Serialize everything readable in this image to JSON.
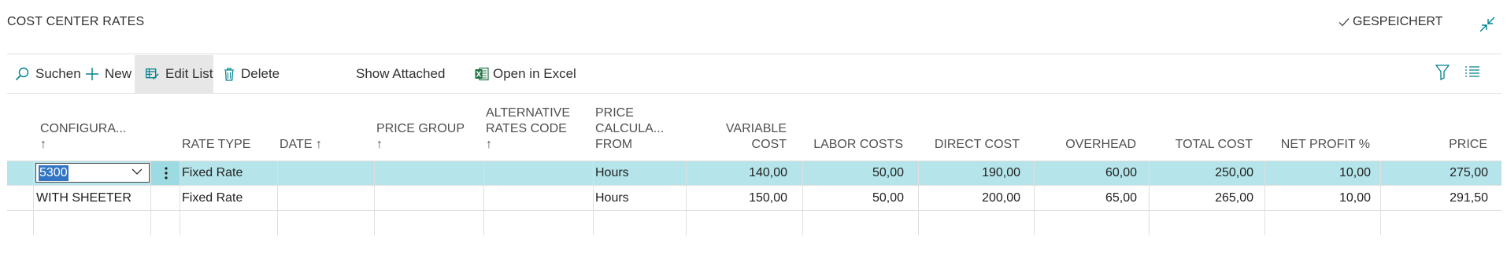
{
  "header": {
    "title": "COST CENTER RATES",
    "saved_label": "GESPEICHERT"
  },
  "actions": {
    "search": "Suchen",
    "new": "New",
    "edit_list": "Edit List",
    "delete": "Delete",
    "show_attached": "Show Attached",
    "open_excel": "Open in Excel"
  },
  "columns": {
    "configuration": "CONFIGURA...",
    "rate_type": "RATE TYPE",
    "date": "DATE",
    "price_group": "PRICE GROUP",
    "alt_rates_code_1": "ALTERNATIVE",
    "alt_rates_code_2": "RATES CODE",
    "price_calc_1": "PRICE",
    "price_calc_2": "CALCULA...",
    "price_calc_3": "FROM",
    "variable_cost_1": "VARIABLE",
    "variable_cost_2": "COST",
    "labor_costs": "LABOR COSTS",
    "direct_cost": "DIRECT COST",
    "overhead": "OVERHEAD",
    "total_cost": "TOTAL COST",
    "net_profit": "NET PROFIT %",
    "price": "PRICE",
    "sort_arrow": "↑"
  },
  "rows": [
    {
      "configuration": "5300",
      "rate_type": "Fixed Rate",
      "date": "",
      "price_group": "",
      "alt_rates_code": "",
      "price_calc_from": "Hours",
      "variable_cost": "140,00",
      "labor_costs": "50,00",
      "direct_cost": "190,00",
      "overhead": "60,00",
      "total_cost": "250,00",
      "net_profit": "10,00",
      "price": "275,00",
      "selected": true
    },
    {
      "configuration": "WITH SHEETER",
      "rate_type": "Fixed Rate",
      "date": "",
      "price_group": "",
      "alt_rates_code": "",
      "price_calc_from": "Hours",
      "variable_cost": "150,00",
      "labor_costs": "50,00",
      "direct_cost": "200,00",
      "overhead": "65,00",
      "total_cost": "265,00",
      "net_profit": "10,00",
      "price": "291,50",
      "selected": false
    }
  ],
  "colors": {
    "selected_row": "#b5e5ea",
    "accent": "#00a2ad",
    "excel_green": "#217346"
  }
}
